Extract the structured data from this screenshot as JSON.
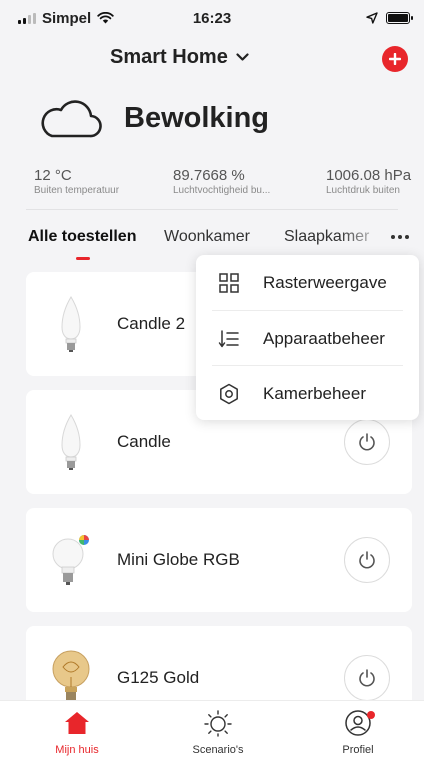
{
  "status_bar": {
    "carrier": "Simpel",
    "time": "16:23"
  },
  "header": {
    "home_name": "Smart Home"
  },
  "weather": {
    "condition": "Bewolking",
    "icon": "cloud-icon"
  },
  "stats": [
    {
      "value": "12 °C",
      "label": "Buiten temperatuur"
    },
    {
      "value": "89.7668 %",
      "label": "Luchtvochtigheid bu..."
    },
    {
      "value": "1006.08 hPa",
      "label": "Luchtdruk buiten"
    }
  ],
  "tabs": [
    "Alle toestellen",
    "Woonkamer",
    "Slaapkamer"
  ],
  "menu": [
    {
      "label": "Rasterweergave",
      "icon": "grid-icon"
    },
    {
      "label": "Apparaatbeheer",
      "icon": "sort-list-icon"
    },
    {
      "label": "Kamerbeheer",
      "icon": "settings-icon"
    }
  ],
  "devices": [
    {
      "name": "Candle 2",
      "icon": "candle-bulb-icon"
    },
    {
      "name": "Candle",
      "icon": "candle-bulb-icon"
    },
    {
      "name": "Mini Globe RGB",
      "icon": "globe-rgb-bulb-icon"
    },
    {
      "name": "G125 Gold",
      "icon": "gold-filament-bulb-icon"
    }
  ],
  "tabbar": [
    {
      "label": "Mijn huis",
      "icon": "home-icon"
    },
    {
      "label": "Scenario's",
      "icon": "sun-icon"
    },
    {
      "label": "Profiel",
      "icon": "profile-icon"
    }
  ],
  "colors": {
    "accent": "#e8262b",
    "background": "#f4f4f6",
    "card": "#ffffff"
  }
}
